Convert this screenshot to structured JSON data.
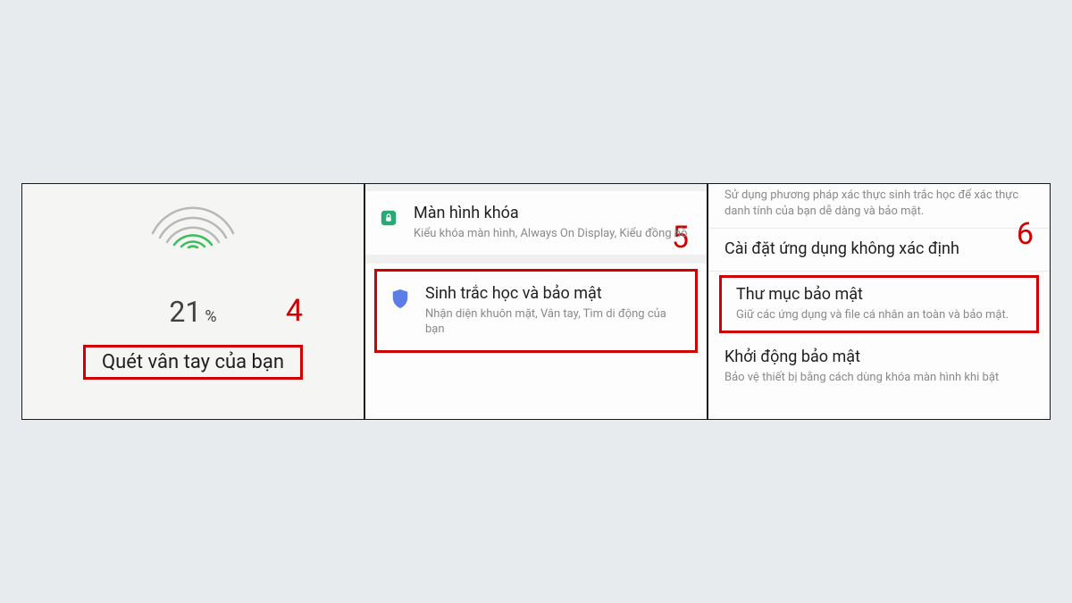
{
  "panel_left": {
    "step_number": "4",
    "percent_value": "21",
    "percent_symbol": "%",
    "scan_instruction": "Quét vân tay của bạn"
  },
  "panel_middle": {
    "step_number": "5",
    "lock_screen": {
      "title": "Màn hình khóa",
      "subtitle": "Kiểu khóa màn hình, Always On Display, Kiểu đồng hồ"
    },
    "biometrics": {
      "title": "Sinh trắc học và bảo mật",
      "subtitle": "Nhận diện khuôn mặt, Vân tay, Tìm di động của bạn"
    }
  },
  "panel_right": {
    "step_number": "6",
    "top_description": "Sử dụng phương pháp xác thực sinh trắc học để xác thực danh tính của bạn dễ dàng và bảo mật.",
    "unknown_apps": {
      "title": "Cài đặt ứng dụng không xác định"
    },
    "secure_folder": {
      "title": "Thư mục bảo mật",
      "subtitle": "Giữ các ứng dụng và file cá nhân an toàn và bảo mật."
    },
    "secure_startup": {
      "title": "Khởi động bảo mật",
      "subtitle": "Bảo vệ thiết bị bằng cách dùng khóa màn hình khi bật"
    }
  }
}
